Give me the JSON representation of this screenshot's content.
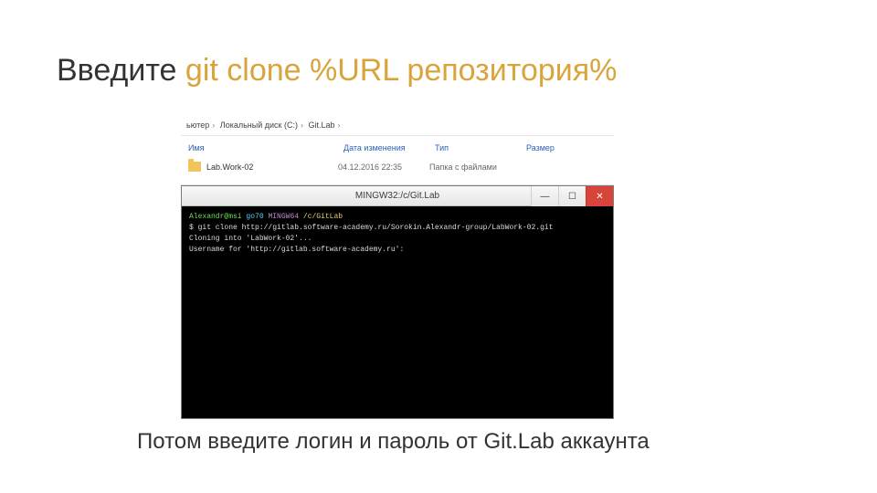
{
  "title": {
    "prefix": "Введите ",
    "highlight": "git clone %URL репозитория%"
  },
  "explorer": {
    "breadcrumb": [
      "ьютер",
      "Локальный диск (C:)",
      "Git.Lab"
    ],
    "columns": {
      "name": "Имя",
      "date": "Дата изменения",
      "type": "Тип",
      "size": "Размер"
    },
    "row": {
      "name": "Lab.Work-02",
      "date": "04.12.2016 22:35",
      "type": "Папка с файлами",
      "size": ""
    }
  },
  "terminal": {
    "title": "MINGW32:/c/Git.Lab",
    "controls": {
      "min": "—",
      "max": "☐",
      "close": "✕"
    },
    "prompt": {
      "user": "Alexandr@msi",
      "host": "go70",
      "sys": "MINGW64",
      "path": "/c/GitLab"
    },
    "lines": {
      "cmd": "$ git clone http://gitlab.software-academy.ru/Sorokin.Alexandr-group/LabWork-02.git",
      "out1": "Cloning into 'LabWork-02'...",
      "out2": "Username for 'http://gitlab.software-academy.ru':"
    }
  },
  "footer": "Потом введите логин и пароль от Git.Lab аккаунта"
}
